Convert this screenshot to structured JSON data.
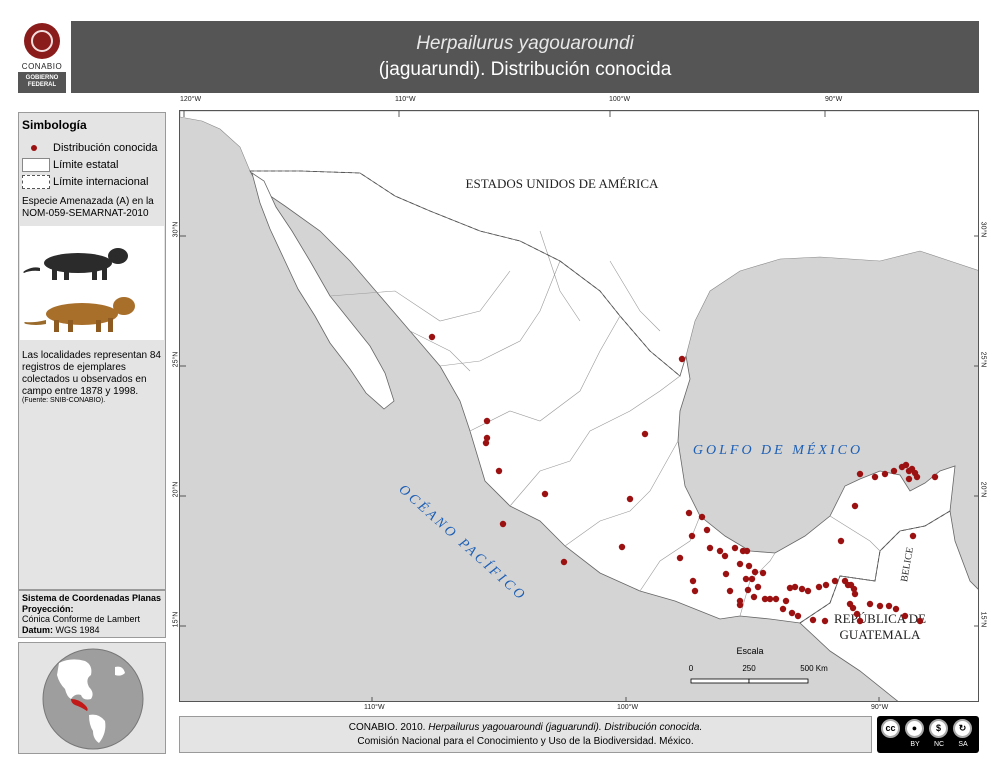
{
  "header": {
    "title_species": "Herpailurus yagouaroundi",
    "title_rest": "(jaguarundi). Distribución conocida",
    "logo_text": "CONABIO",
    "gov_line1": "GOBIERNO",
    "gov_line2": "FEDERAL"
  },
  "legend": {
    "title": "Simbología",
    "items": [
      {
        "label": "Distribución conocida",
        "symbol": "point"
      },
      {
        "label": "Límite estatal",
        "symbol": "solid-box"
      },
      {
        "label": "Límite internacional",
        "symbol": "dashed-box"
      }
    ],
    "status": "Especie Amenazada (A) en la NOM-059-SEMARNAT-2010",
    "notes": "Las localidades representan 84 registros de ejemplares colectados u observados en campo entre 1878 y 1998.",
    "source": "(Fuente: SNIB-CONABIO)."
  },
  "coordinate_system": {
    "title": "Sistema de Coordenadas Planas",
    "projection_label": "Proyección:",
    "projection": "Cónica Conforme de Lambert",
    "datum_label": "Datum:",
    "datum": "WGS 1984"
  },
  "map": {
    "labels": {
      "usa": "ESTADOS UNIDOS DE AMÉRICA",
      "gulf": "GOLFO DE MÉXICO",
      "pacific": "OCÉANO PACÍFICO",
      "belize": "BELICE",
      "guatemala_1": "REPÚBLICA DE",
      "guatemala_2": "GUATEMALA"
    },
    "longitude_ticks_top": [
      "120°W",
      "110°W",
      "100°W",
      "90°W"
    ],
    "longitude_ticks_bottom": [
      "110°W",
      "100°W",
      "90°W"
    ],
    "latitude_ticks": [
      "30°N",
      "25°N",
      "20°N",
      "15°N"
    ],
    "scale": {
      "title": "Escala",
      "ticks": [
        "0",
        "250",
        "500 Km"
      ]
    },
    "point_color": "#9b1111",
    "land_color": "#ffffff",
    "water_color": "#d4d4d4",
    "record_count": 84
  },
  "footer": {
    "citation_prefix": "CONABIO. 2010.",
    "citation_species": "Herpailurus yagouaroundi (jaguarundi). Distribución conocida.",
    "citation_line2": "Comisión Nacional para el Conocimiento y Uso de la Biodiversidad. México.",
    "license": [
      "BY",
      "NC",
      "SA"
    ],
    "license_icons": [
      "cc-icon",
      "attribution-icon",
      "noncommercial-icon",
      "sharealike-icon"
    ]
  }
}
